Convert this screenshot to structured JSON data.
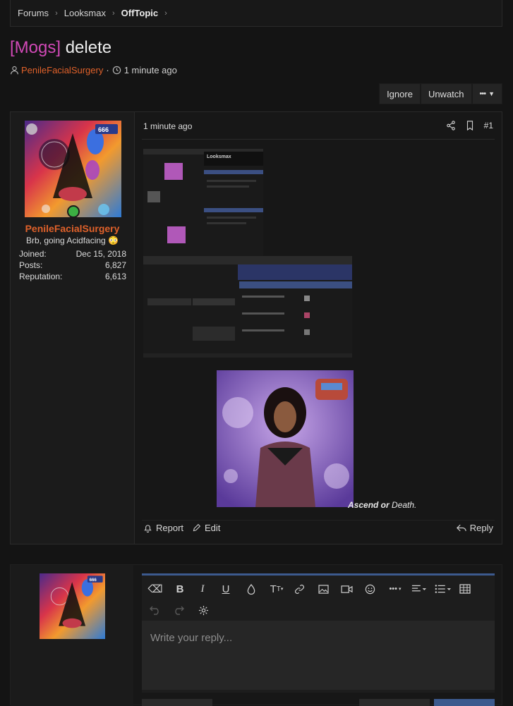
{
  "breadcrumb": {
    "items": [
      "Forums",
      "Looksmax",
      "OffTopic"
    ]
  },
  "thread": {
    "prefix": "[Mogs]",
    "title": "delete",
    "author": "PenileFacialSurgery",
    "time": "1 minute ago"
  },
  "actions": {
    "ignore": "Ignore",
    "unwatch": "Unwatch",
    "more": "•••"
  },
  "post": {
    "user": {
      "name": "PenileFacialSurgery",
      "title": "Brb, going Acidfacing 😳",
      "stats": [
        {
          "label": "Joined:",
          "value": "Dec 15, 2018"
        },
        {
          "label": "Posts:",
          "value": "6,827"
        },
        {
          "label": "Reputation:",
          "value": "6,613"
        }
      ]
    },
    "time": "1 minute ago",
    "number": "#1",
    "screenshot_logo": "Looksmax",
    "signature": {
      "bold": "Ascend or",
      "italic": "Death."
    },
    "footer": {
      "report": "Report",
      "edit": "Edit",
      "reply": "Reply"
    }
  },
  "editor": {
    "placeholder": "Write your reply..."
  },
  "colors": {
    "accent": "#3c5a8e",
    "username": "#e0612a",
    "prefix": "#d149b6",
    "online": "#3cb043"
  }
}
